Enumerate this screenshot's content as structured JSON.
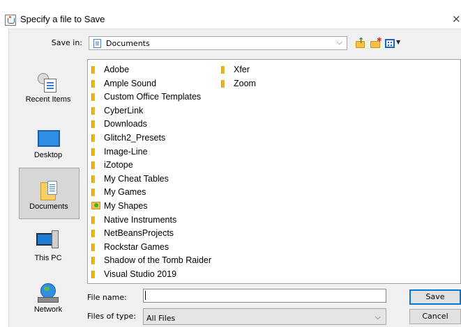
{
  "window": {
    "title": "Specify a file to Save",
    "close_glyph": "×",
    "icon": "java-cup-icon"
  },
  "toolbar": {
    "save_in_label": "Save in:",
    "save_in_value": "Documents",
    "combo_arrow": "⌵",
    "buttons": [
      {
        "name": "up-one-level-icon"
      },
      {
        "name": "create-new-folder-icon"
      },
      {
        "name": "view-menu-icon"
      }
    ]
  },
  "places": [
    {
      "label": "Recent Items",
      "icon": "recent-items-icon"
    },
    {
      "label": "Desktop",
      "icon": "desktop-icon"
    },
    {
      "label": "Documents",
      "icon": "documents-icon",
      "selected": true
    },
    {
      "label": "This PC",
      "icon": "this-pc-icon"
    },
    {
      "label": "Network",
      "icon": "network-icon"
    }
  ],
  "files": [
    {
      "name": "Adobe",
      "icon": "folder-icon"
    },
    {
      "name": "Ample Sound",
      "icon": "folder-icon"
    },
    {
      "name": "Custom Office Templates",
      "icon": "folder-icon"
    },
    {
      "name": "CyberLink",
      "icon": "folder-icon"
    },
    {
      "name": "Downloads",
      "icon": "folder-icon"
    },
    {
      "name": "Glitch2_Presets",
      "icon": "folder-icon"
    },
    {
      "name": "Image-Line",
      "icon": "folder-icon"
    },
    {
      "name": "iZotope",
      "icon": "folder-icon"
    },
    {
      "name": "My Cheat Tables",
      "icon": "folder-icon"
    },
    {
      "name": "My Games",
      "icon": "folder-icon"
    },
    {
      "name": "My Shapes",
      "icon": "shapes-folder-icon"
    },
    {
      "name": "Native Instruments",
      "icon": "folder-icon"
    },
    {
      "name": "NetBeansProjects",
      "icon": "folder-icon"
    },
    {
      "name": "Rockstar Games",
      "icon": "folder-icon"
    },
    {
      "name": "Shadow of the Tomb Raider",
      "icon": "folder-icon"
    },
    {
      "name": "Visual Studio 2019",
      "icon": "folder-icon"
    },
    {
      "name": "Xfer",
      "icon": "folder-icon"
    },
    {
      "name": "Zoom",
      "icon": "folder-icon"
    }
  ],
  "form": {
    "file_name_label": "File name:",
    "file_name_value": "",
    "file_type_label": "Files of type:",
    "file_type_value": "All Files",
    "combo_arrow": "⌵"
  },
  "buttons": {
    "save": "Save",
    "cancel": "Cancel"
  }
}
